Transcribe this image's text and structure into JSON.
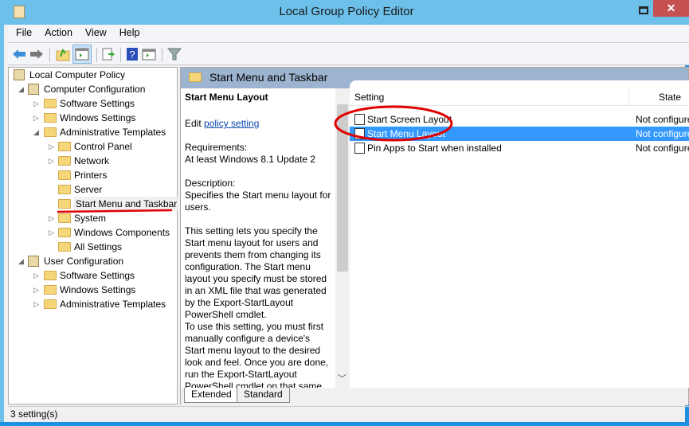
{
  "window": {
    "title": "Local Group Policy Editor",
    "close": "✕"
  },
  "menu": [
    "File",
    "Action",
    "View",
    "Help"
  ],
  "toolbar": [
    "back-icon",
    "forward-icon",
    "up-folder-icon",
    "show-hide-tree-icon",
    "export-list-icon",
    "help-icon",
    "show-action-pane-icon",
    "filter-icon"
  ],
  "tree": [
    {
      "label": "Local Computer Policy",
      "level": 0,
      "arrow": ""
    },
    {
      "label": "Computer Configuration",
      "level": 1,
      "arrow": "◢"
    },
    {
      "label": "Software Settings",
      "level": 2,
      "arrow": "▷"
    },
    {
      "label": "Windows Settings",
      "level": 2,
      "arrow": "▷"
    },
    {
      "label": "Administrative Templates",
      "level": 2,
      "arrow": "◢"
    },
    {
      "label": "Control Panel",
      "level": 3,
      "arrow": "▷"
    },
    {
      "label": "Network",
      "level": 3,
      "arrow": "▷"
    },
    {
      "label": "Printers",
      "level": 3,
      "arrow": ""
    },
    {
      "label": "Server",
      "level": 3,
      "arrow": ""
    },
    {
      "label": "Start Menu and Taskbar",
      "level": 3,
      "arrow": "",
      "selected": true
    },
    {
      "label": "System",
      "level": 3,
      "arrow": "▷"
    },
    {
      "label": "Windows Components",
      "level": 3,
      "arrow": "▷"
    },
    {
      "label": "All Settings",
      "level": 3,
      "arrow": ""
    },
    {
      "label": "User Configuration",
      "level": 1,
      "arrow": "◢"
    },
    {
      "label": "Software Settings",
      "level": 2,
      "arrow": "▷"
    },
    {
      "label": "Windows Settings",
      "level": 2,
      "arrow": "▷"
    },
    {
      "label": "Administrative Templates",
      "level": 2,
      "arrow": "▷"
    }
  ],
  "header": {
    "title": "Start Menu and Taskbar"
  },
  "description": {
    "title": "Start Menu Layout",
    "edit_prefix": "Edit ",
    "edit_link": "policy setting",
    "requirements_label": "Requirements:",
    "requirements": "At least Windows 8.1 Update 2",
    "description_label": "Description:",
    "description": "Specifies the Start menu layout for users.",
    "body": "This setting lets you specify the Start menu layout for users and prevents them from changing its configuration. The Start menu layout you specify must be stored in an XML file that was generated by the Export-StartLayout PowerShell cmdlet.",
    "body2": "To use this setting, you must first manually configure a device's Start menu layout to the desired look and feel. Once you are done, run the Export-StartLayout PowerShell cmdlet on that same"
  },
  "list": {
    "columns": [
      "Setting",
      "State"
    ],
    "rows": [
      {
        "setting": "Start Screen Layout",
        "state": "Not configured"
      },
      {
        "setting": "Start Menu Layout",
        "state": "Not configured",
        "selected": true
      },
      {
        "setting": "Pin Apps to Start when installed",
        "state": "Not configured"
      }
    ]
  },
  "tabs": [
    "Extended",
    "Standard"
  ],
  "status": "3 setting(s)",
  "colors": {
    "titlebar": "#6cc0ea",
    "close": "#c75050",
    "selection": "#3399ff",
    "header": "#9db4d0",
    "annotation": "#e00000"
  }
}
